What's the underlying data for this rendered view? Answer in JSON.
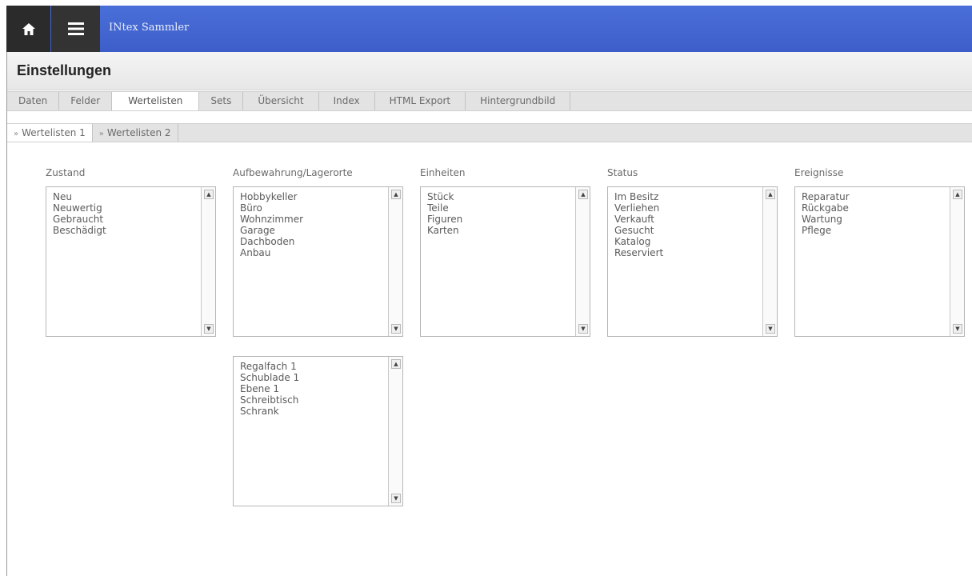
{
  "app": {
    "title": "INtex Sammler"
  },
  "page": {
    "title": "Einstellungen"
  },
  "tabs": [
    "Daten",
    "Felder",
    "Wertelisten",
    "Sets",
    "Übersicht",
    "Index",
    "HTML Export",
    "Hintergrundbild"
  ],
  "subtabs": [
    "Wertelisten 1",
    "Wertelisten 2"
  ],
  "lists": [
    {
      "label": "Zustand",
      "items": [
        "Neu",
        "Neuwertig",
        "Gebraucht",
        "Beschädigt"
      ]
    },
    {
      "label": "Aufbewahrung/Lagerorte",
      "items": [
        "Hobbykeller",
        "Büro",
        "Wohnzimmer",
        "Garage",
        "Dachboden",
        "Anbau"
      ]
    },
    {
      "label": "Einheiten",
      "items": [
        "Stück",
        "Teile",
        "Figuren",
        "Karten"
      ]
    },
    {
      "label": "Status",
      "items": [
        "Im Besitz",
        "Verliehen",
        "Verkauft",
        "Gesucht",
        "Katalog",
        "Reserviert"
      ]
    },
    {
      "label": "Ereignisse",
      "items": [
        "Reparatur",
        "Rückgabe",
        "Wartung",
        "Pflege"
      ]
    },
    {
      "label": "",
      "items": [
        "Regalfach 1",
        "Schublade 1",
        "Ebene 1",
        "Schreibtisch",
        "Schrank"
      ]
    }
  ],
  "icons": {
    "home": "home-icon",
    "menu": "hamburger-menu-icon",
    "scroll_up": "triangle-up-icon",
    "scroll_down": "triangle-down-icon"
  },
  "colors": {
    "topbar": "#4466d4",
    "topbar_buttons": "#2b2b2b"
  }
}
